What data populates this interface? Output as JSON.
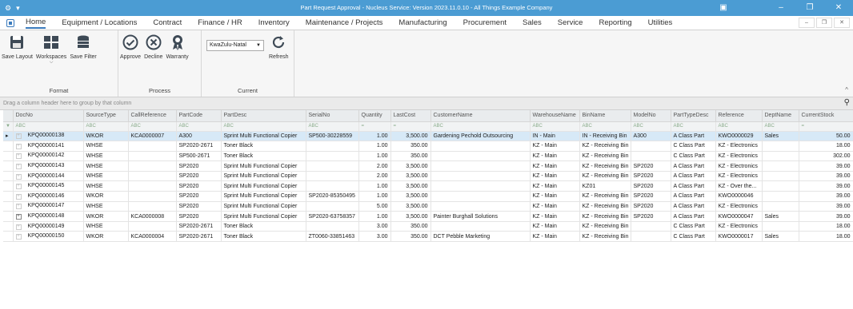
{
  "window": {
    "title": "Part Request Approval - Nucleus Service: Version 2023.11.0.10 - All Things Example Company",
    "left_icons": [
      "⚙",
      "▾"
    ]
  },
  "menu": {
    "items": [
      "Home",
      "Equipment / Locations",
      "Contract",
      "Finance / HR",
      "Inventory",
      "Maintenance / Projects",
      "Manufacturing",
      "Procurement",
      "Sales",
      "Service",
      "Reporting",
      "Utilities"
    ]
  },
  "ribbon": {
    "format": {
      "label": "Format",
      "save_layout": "Save Layout",
      "workspaces": "Workspaces",
      "workspaces_arrow": "⌵",
      "save_filter": "Save Filter"
    },
    "process": {
      "label": "Process",
      "approve": "Approve",
      "decline": "Decline",
      "warranty": "Warranty"
    },
    "current": {
      "label": "Current",
      "region": "KwaZulu-Natal",
      "refresh": "Refresh"
    }
  },
  "grid": {
    "group_hint": "Drag a column header here to group by that column",
    "columns": [
      "",
      "DocNo",
      "SourceType",
      "CallReference",
      "PartCode",
      "PartDesc",
      "SerialNo",
      "Quantity",
      "LastCost",
      "CustomerName",
      "WarehouseName",
      "BinName",
      "ModelNo",
      "PartTypeDesc",
      "Reference",
      "DeptName",
      "CurrentStock"
    ],
    "filter_row": [
      "▼",
      "ABC",
      "ABC",
      "ABC",
      "ABC",
      "ABC",
      "ABC",
      "=",
      "=",
      "ABC",
      "ABC",
      "ABC",
      "ABC",
      "ABC",
      "ABC",
      "ABC",
      "="
    ],
    "rows": [
      [
        "▸",
        "KPQ00000138",
        "WKOR",
        "KCA0000007",
        "A300",
        "Sprint Multi Functional Copier",
        "SP500-30228559",
        "1.00",
        "3,500.00",
        "Gardening Pechold Outsourcing",
        "IN - Main",
        "IN - Receiving Bin",
        "A300",
        "A Class Part",
        "KWO0000029",
        "Sales",
        "50.00"
      ],
      [
        "",
        "KPQ00000141",
        "WHSE",
        "",
        "SP2020-2671",
        "Toner Black",
        "",
        "1.00",
        "350.00",
        "",
        "KZ - Main",
        "KZ - Receiving Bin",
        "",
        "C Class Part",
        "KZ - Electronics",
        "",
        "18.00"
      ],
      [
        "",
        "KPQ00000142",
        "WHSE",
        "",
        "SP500-2671",
        "Toner Black",
        "",
        "1.00",
        "350.00",
        "",
        "KZ - Main",
        "KZ - Receiving Bin",
        "",
        "C Class Part",
        "KZ - Electronics",
        "",
        "302.00"
      ],
      [
        "",
        "KPQ00000143",
        "WHSE",
        "",
        "SP2020",
        "Sprint Multi Functional Copier",
        "",
        "2.00",
        "3,500.00",
        "",
        "KZ - Main",
        "KZ - Receiving Bin",
        "SP2020",
        "A Class Part",
        "KZ - Electronics",
        "",
        "39.00"
      ],
      [
        "",
        "KPQ00000144",
        "WHSE",
        "",
        "SP2020",
        "Sprint Multi Functional Copier",
        "",
        "2.00",
        "3,500.00",
        "",
        "KZ - Main",
        "KZ - Receiving Bin",
        "SP2020",
        "A Class Part",
        "KZ - Electronics",
        "",
        "39.00"
      ],
      [
        "",
        "KPQ00000145",
        "WHSE",
        "",
        "SP2020",
        "Sprint Multi Functional Copier",
        "",
        "1.00",
        "3,500.00",
        "",
        "KZ - Main",
        "KZ01",
        "SP2020",
        "A Class Part",
        "KZ - Over the...",
        "",
        "39.00"
      ],
      [
        "",
        "KPQ00000146",
        "WKOR",
        "",
        "SP2020",
        "Sprint Multi Functional Copier",
        "SP2020-85350495",
        "1.00",
        "3,500.00",
        "",
        "KZ - Main",
        "KZ - Receiving Bin",
        "SP2020",
        "A Class Part",
        "KWO0000046",
        "",
        "39.00"
      ],
      [
        "",
        "KPQ00000147",
        "WHSE",
        "",
        "SP2020",
        "Sprint Multi Functional Copier",
        "",
        "5.00",
        "3,500.00",
        "",
        "KZ - Main",
        "KZ - Receiving Bin",
        "SP2020",
        "A Class Part",
        "KZ - Electronics",
        "",
        "39.00"
      ],
      [
        "",
        "KPQ00000148",
        "WKOR",
        "KCA0000008",
        "SP2020",
        "Sprint Multi Functional Copier",
        "SP2020-63758357",
        "1.00",
        "3,500.00",
        "Painter Burghall Solutions",
        "KZ - Main",
        "KZ - Receiving Bin",
        "SP2020",
        "A Class Part",
        "KWO0000047",
        "Sales",
        "39.00"
      ],
      [
        "",
        "KPQ00000149",
        "WHSE",
        "",
        "SP2020-2671",
        "Toner Black",
        "",
        "3.00",
        "350.00",
        "",
        "KZ - Main",
        "KZ - Receiving Bin",
        "",
        "C Class Part",
        "KZ - Electronics",
        "",
        "18.00"
      ],
      [
        "",
        "KPQ00000150",
        "WKOR",
        "KCA0000004",
        "SP2020-2671",
        "Toner Black",
        "ZT0060-33851463",
        "3.00",
        "350.00",
        "DCT Pebble Marketing",
        "KZ - Main",
        "KZ - Receiving Bin",
        "",
        "C Class Part",
        "KWO0000017",
        "Sales",
        "18.00"
      ]
    ],
    "expanders": [
      "dim",
      "dim",
      "dim",
      "dim",
      "dim",
      "dim",
      "dim",
      "dim",
      "solid",
      "dim",
      "dim"
    ]
  },
  "colors": {
    "titlebar": "#4b9cd3",
    "selected_row": "#d7e9f7",
    "accent": "#3b7bbd"
  }
}
